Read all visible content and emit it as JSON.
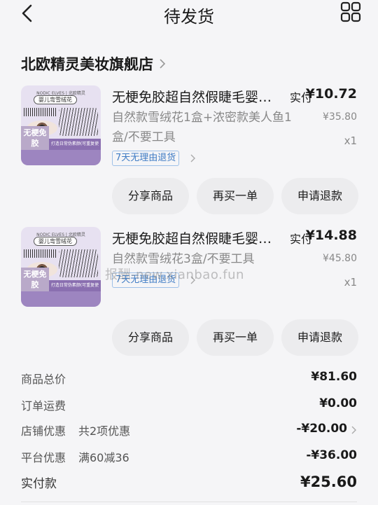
{
  "header": {
    "title": "待发货"
  },
  "shop": {
    "name": "北欧精灵美妆旗舰店"
  },
  "items": [
    {
      "thumb": {
        "brand": "NODIC ELVES | 北欧精灵",
        "pill": "婴儿弯雪绒花",
        "badge": "无梗免胶",
        "bar": "打造日常伪素颜(可重复使用"
      },
      "title": "无梗免胶超自然假睫毛婴儿弯雪绒花",
      "spec": "自然款雪绒花1盒+浓密款美人鱼1盒/不要工具",
      "tag": "7天无理由退货",
      "paid_label": "实付",
      "paid_price": "¥10.72",
      "original_price": "¥35.80",
      "qty": "x1",
      "buttons": {
        "share": "分享商品",
        "rebuy": "再买一单",
        "refund": "申请退款"
      }
    },
    {
      "thumb": {
        "brand": "NODIC ELVES | 北欧精灵",
        "pill": "婴儿弯雪绒花",
        "badge": "无梗免胶",
        "bar": "打造日常伪素颜(可重复使用"
      },
      "title": "无梗免胶超自然假睫毛婴儿弯雪绒花",
      "spec": "自然款雪绒花3盒/不要工具",
      "tag": "7天无理由退货",
      "paid_label": "实付",
      "paid_price": "¥14.88",
      "original_price": "¥45.80",
      "qty": "x1",
      "buttons": {
        "share": "分享商品",
        "rebuy": "再买一单",
        "refund": "申请退款"
      }
    }
  ],
  "watermark": "报酬-new.xianbao.fun",
  "summary": {
    "goods_total": {
      "label": "商品总价",
      "value": "¥81.60"
    },
    "shipping": {
      "label": "订单运费",
      "value": "¥0.00"
    },
    "shop_discount": {
      "label": "店铺优惠",
      "detail": "共2项优惠",
      "value": "-¥20.00"
    },
    "platform_discount": {
      "label": "平台优惠",
      "detail": "满60减36",
      "value": "-¥36.00"
    },
    "paid_total": {
      "label": "实付款",
      "value": "¥25.60"
    }
  },
  "colors": {
    "background": "#f5f5f7",
    "tag_blue": "#3e7bc4",
    "button_bg": "#ececee"
  }
}
